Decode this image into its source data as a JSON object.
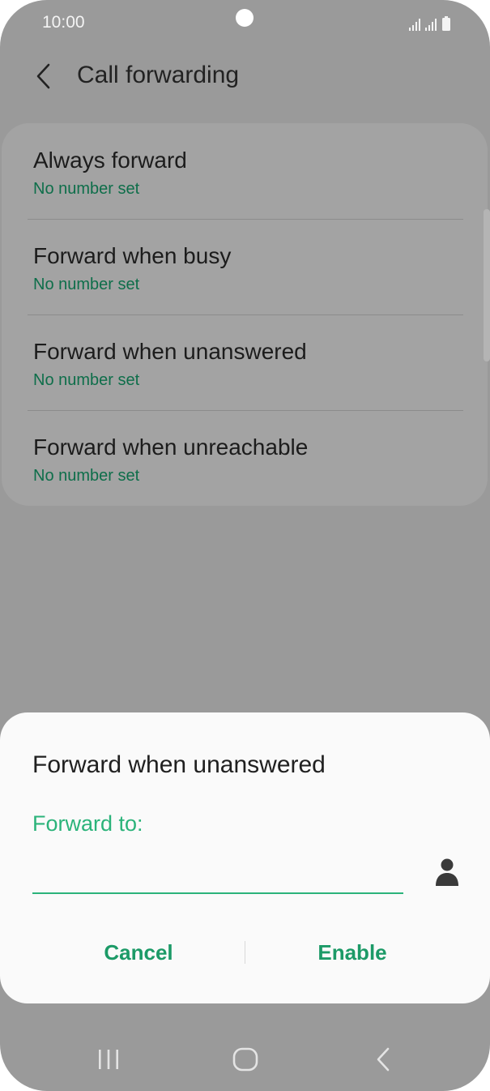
{
  "status_bar": {
    "time": "10:00"
  },
  "header": {
    "title": "Call forwarding"
  },
  "list": {
    "items": [
      {
        "label": "Always forward",
        "sub": "No number set"
      },
      {
        "label": "Forward when busy",
        "sub": "No number set"
      },
      {
        "label": "Forward when unanswered",
        "sub": "No number set"
      },
      {
        "label": "Forward when unreachable",
        "sub": "No number set"
      }
    ]
  },
  "dialog": {
    "title": "Forward when unanswered",
    "field_label": "Forward to:",
    "field_value": "",
    "cancel_label": "Cancel",
    "enable_label": "Enable"
  },
  "icons": {
    "back": "chevron-left-icon",
    "contact": "person-icon",
    "nav_recents": "recent-apps-icon",
    "nav_home": "home-icon",
    "nav_back": "back-icon"
  },
  "colors": {
    "accent": "#2bb37a",
    "accent_dark": "#1c9a67",
    "sub_text": "#0e6e4a"
  }
}
